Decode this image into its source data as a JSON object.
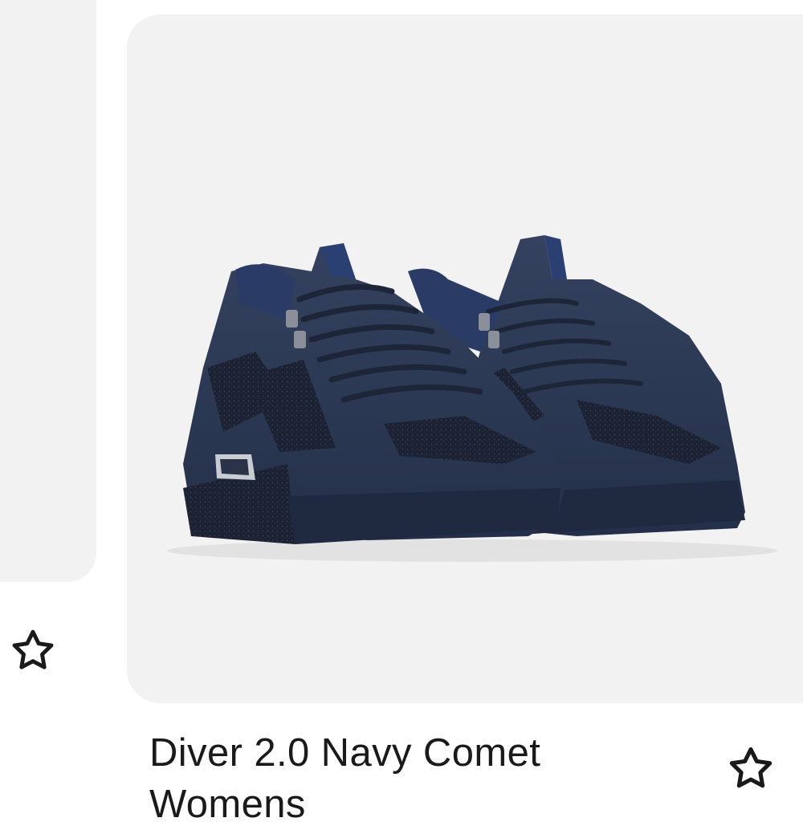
{
  "product": {
    "title": "Diver 2.0 Navy Comet Womens"
  },
  "icons": {
    "favorite_left": "star-outline-icon",
    "favorite_right": "star-outline-icon"
  },
  "colors": {
    "card_background": "#f2f2f2",
    "shoe_navy": "#2b3a55",
    "text": "#1a1a1a"
  }
}
